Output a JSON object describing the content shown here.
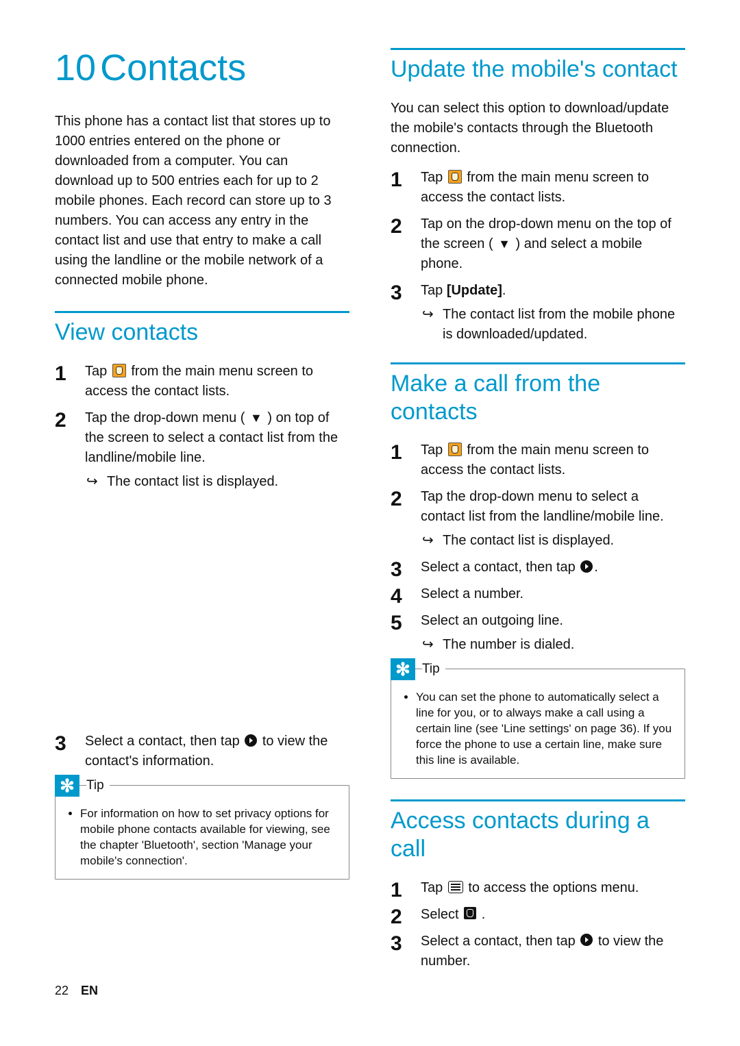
{
  "chapter": {
    "number": "10",
    "title": "Contacts"
  },
  "intro": "This phone has a contact list that stores up to 1000 entries entered on the phone or downloaded from a computer. You can download up to 500 entries each for up to 2 mobile phones. Each record can store up to 3 numbers. You can access any entry in the contact list and use that entry to make a call using the landline or the mobile network of a connected mobile phone.",
  "view": {
    "title": "View contacts",
    "s1a": "Tap ",
    "s1b": " from the main menu screen to access the contact lists.",
    "s2a": "Tap the drop-down menu ( ",
    "s2b": " ) on top of the screen to select a contact list from the landline/mobile line.",
    "r2": "The contact list is displayed.",
    "s3a": "Select a contact, then tap ",
    "s3b": " to view the contact's information."
  },
  "tip1": {
    "label": "Tip",
    "text": "For information on how to set privacy options for mobile phone contacts available for viewing, see the chapter 'Bluetooth', section 'Manage your mobile's connection'."
  },
  "update": {
    "title": "Update the mobile's contact",
    "intro": "You can select this option to download/update the mobile's contacts through the Bluetooth connection.",
    "s1a": "Tap ",
    "s1b": " from the main menu screen to access the contact lists.",
    "s2a": "Tap on the drop-down menu on the top of the screen ( ",
    "s2b": " ) and select a mobile phone.",
    "s3a": "Tap ",
    "s3b": "[Update]",
    "s3c": ".",
    "r3": "The contact list from the mobile phone is downloaded/updated."
  },
  "call": {
    "title": "Make a call from the contacts",
    "s1a": "Tap ",
    "s1b": " from the main menu screen to access the contact lists.",
    "s2": "Tap the drop-down menu to select a contact list from the landline/mobile line.",
    "r2": "The contact list is displayed.",
    "s3a": "Select a contact, then tap ",
    "s3b": ".",
    "s4": "Select a number.",
    "s5": "Select an outgoing line.",
    "r5": "The number is dialed."
  },
  "tip2": {
    "label": "Tip",
    "text": "You can set the phone to automatically select a line for you, or to always make a call using a certain line (see 'Line settings' on page 36). If you force the phone to use a certain line, make sure this line is available."
  },
  "access": {
    "title": "Access contacts during a call",
    "s1a": "Tap ",
    "s1b": " to access the options menu.",
    "s2a": "Select ",
    "s2b": " .",
    "s3a": "Select a contact, then tap ",
    "s3b": " to view the number."
  },
  "footer": {
    "page": "22",
    "lang": "EN"
  }
}
